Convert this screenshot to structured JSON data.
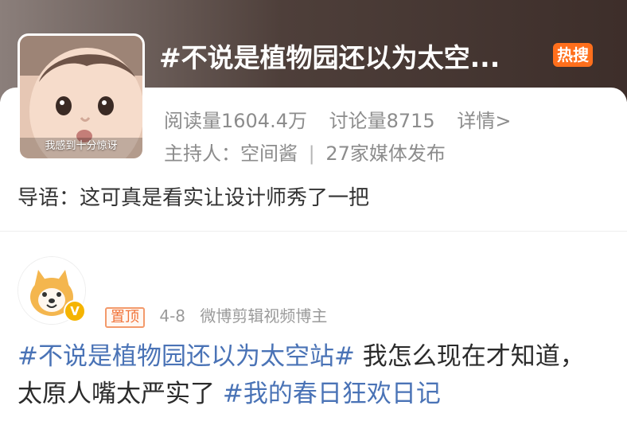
{
  "topic_card": {
    "avatar_caption": "我感到十分惊讶",
    "title": "#不说是植物园还以为太空...",
    "hot_badge": "热搜",
    "stats": {
      "reads": "阅读量1604.4万",
      "discussions": "讨论量8715",
      "details_link": "详情>"
    },
    "host": {
      "host": "主持人：空间酱",
      "separator": "|",
      "media": "27家媒体发布"
    },
    "intro": "导语：这可真是看实让设计师秀了一把"
  },
  "post": {
    "pin_tag": "置顶",
    "date": "4-8",
    "author_role": "微博剪辑视频博主",
    "verify_symbol": "V",
    "body": {
      "topic_1": "#不说是植物园还以为太空站#",
      "text": " 我怎么现在才知道，太原人嘴太严实了 ",
      "topic_2": "#我的春日狂欢日记"
    }
  },
  "colors": {
    "hot_badge": "#ff6f1c",
    "topic_link": "#4a73b6",
    "pin_tag": "#f17339"
  }
}
